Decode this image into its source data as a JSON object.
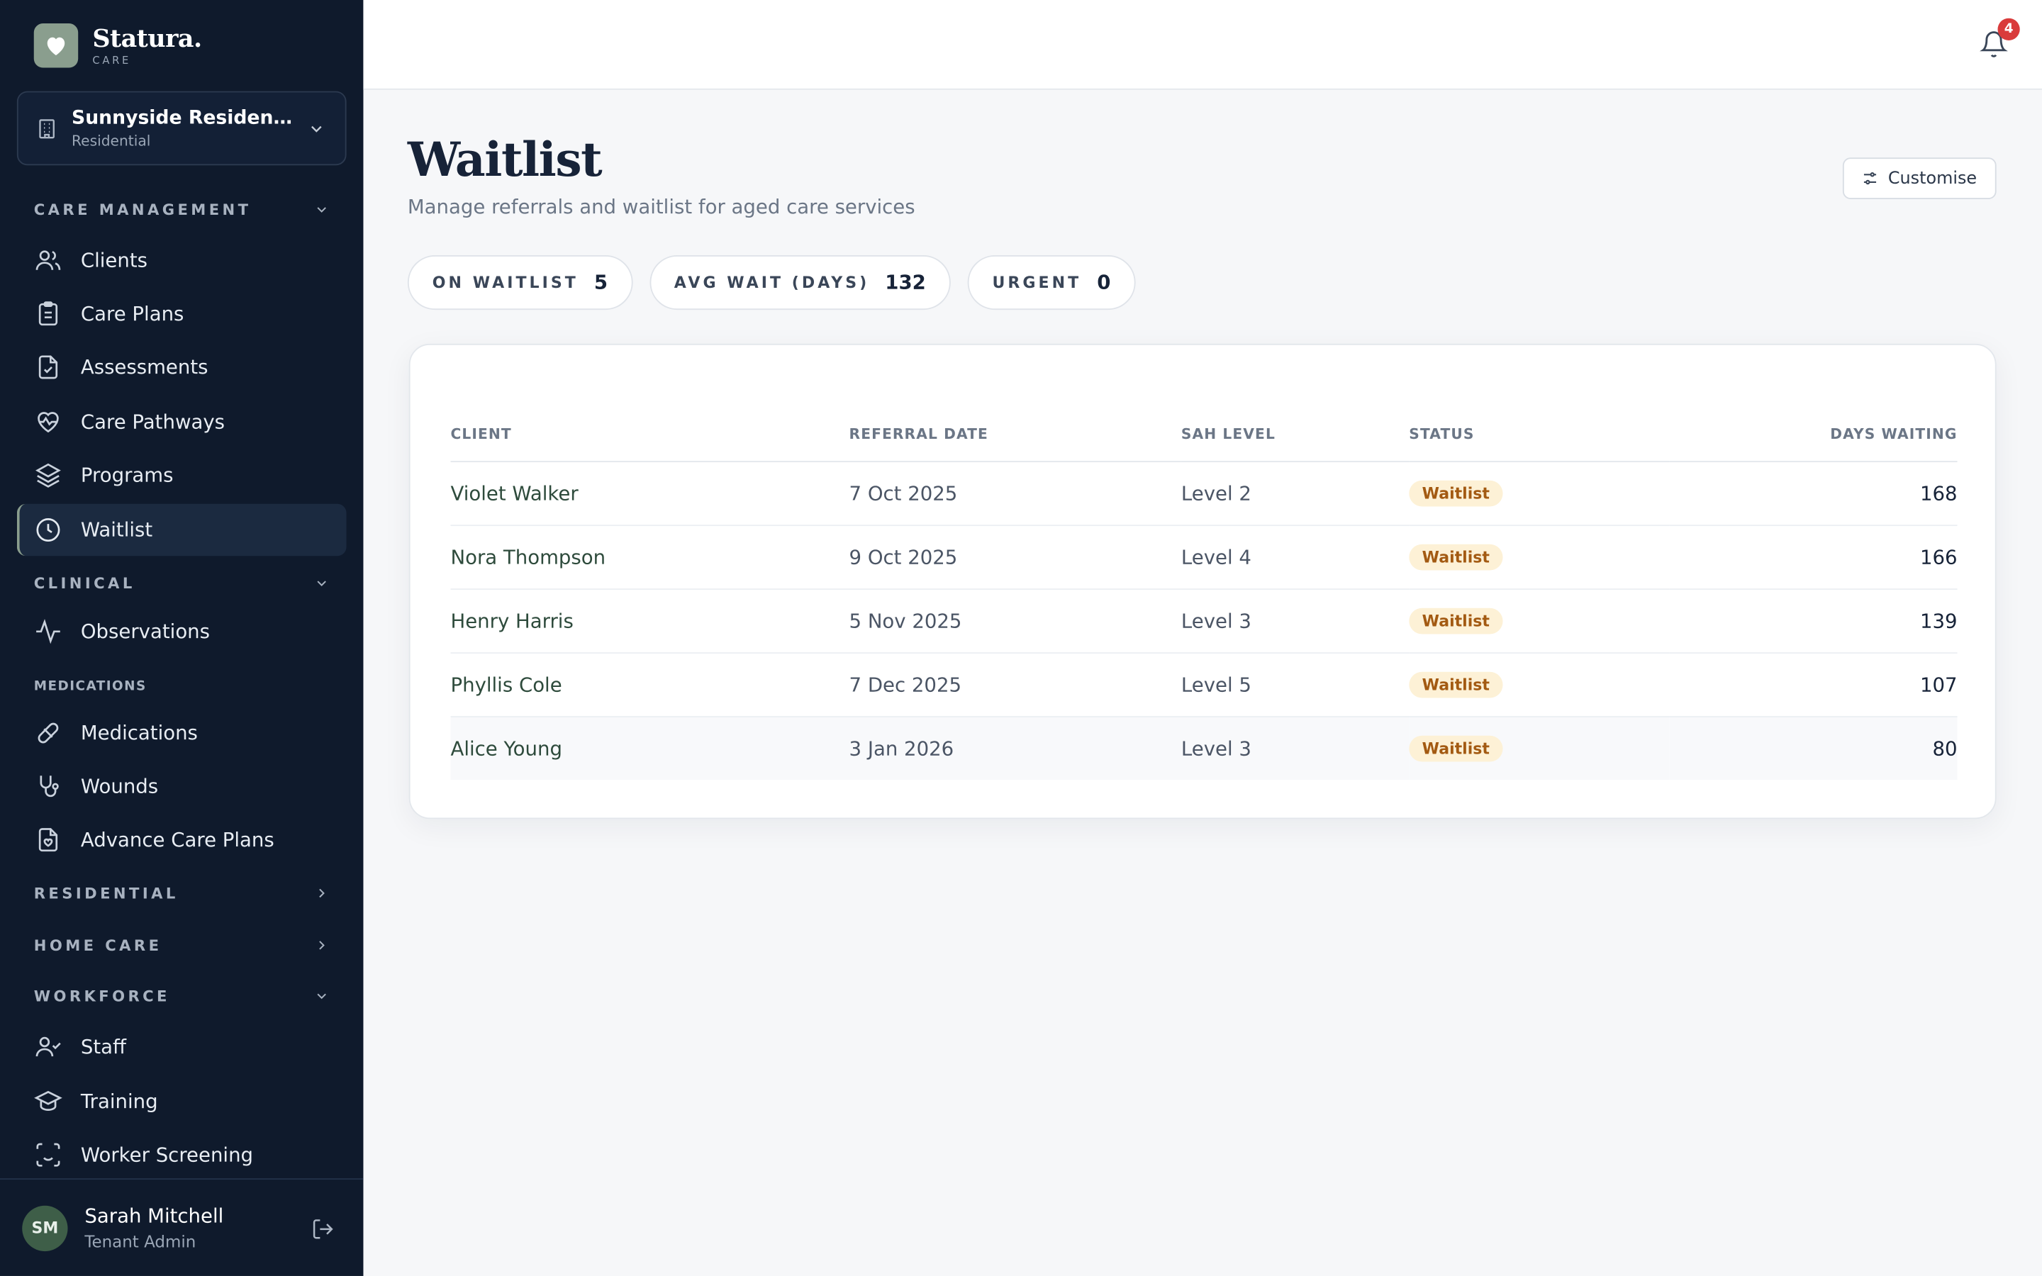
{
  "brand": {
    "name": "Statura.",
    "sub": "CARE"
  },
  "facility": {
    "name": "Sunnyside Residentia...",
    "type": "Residential"
  },
  "sidebar": {
    "sections": {
      "care_management": "CARE MANAGEMENT",
      "clinical": "CLINICAL",
      "medications": "MEDICATIONS",
      "residential": "RESIDENTIAL",
      "home_care": "HOME CARE",
      "workforce": "WORKFORCE"
    },
    "items": {
      "clients": "Clients",
      "care_plans": "Care Plans",
      "assessments": "Assessments",
      "care_pathways": "Care Pathways",
      "programs": "Programs",
      "waitlist": "Waitlist",
      "observations": "Observations",
      "medications": "Medications",
      "wounds": "Wounds",
      "advance_care_plans": "Advance Care Plans",
      "staff": "Staff",
      "training": "Training",
      "worker_screening": "Worker Screening"
    },
    "active_item": "waitlist"
  },
  "user": {
    "initials": "SM",
    "name": "Sarah Mitchell",
    "role": "Tenant Admin"
  },
  "header": {
    "notification_count": "4"
  },
  "page": {
    "title": "Waitlist",
    "subtitle": "Manage referrals and waitlist for aged care services",
    "customise_label": "Customise"
  },
  "stats": [
    {
      "label": "ON WAITLIST",
      "value": "5"
    },
    {
      "label": "AVG WAIT (DAYS)",
      "value": "132"
    },
    {
      "label": "URGENT",
      "value": "0"
    }
  ],
  "table": {
    "columns": [
      "CLIENT",
      "REFERRAL DATE",
      "SAH LEVEL",
      "STATUS",
      "DAYS WAITING"
    ],
    "rows": [
      {
        "client": "Violet Walker",
        "referral_date": "7 Oct 2025",
        "level": "Level 2",
        "status": "Waitlist",
        "days": "168"
      },
      {
        "client": "Nora Thompson",
        "referral_date": "9 Oct 2025",
        "level": "Level 4",
        "status": "Waitlist",
        "days": "166"
      },
      {
        "client": "Henry Harris",
        "referral_date": "5 Nov 2025",
        "level": "Level 3",
        "status": "Waitlist",
        "days": "139"
      },
      {
        "client": "Phyllis Cole",
        "referral_date": "7 Dec 2025",
        "level": "Level 5",
        "status": "Waitlist",
        "days": "107"
      },
      {
        "client": "Alice Young",
        "referral_date": "3 Jan 2026",
        "level": "Level 3",
        "status": "Waitlist",
        "days": "80"
      }
    ]
  },
  "colors": {
    "sidebar_bg": "#0f1a2c",
    "brand_accent": "#8a9e8e",
    "status_pill_bg": "#fdf1d6",
    "status_pill_text": "#a35a12",
    "notification_badge": "#d93b3b"
  }
}
